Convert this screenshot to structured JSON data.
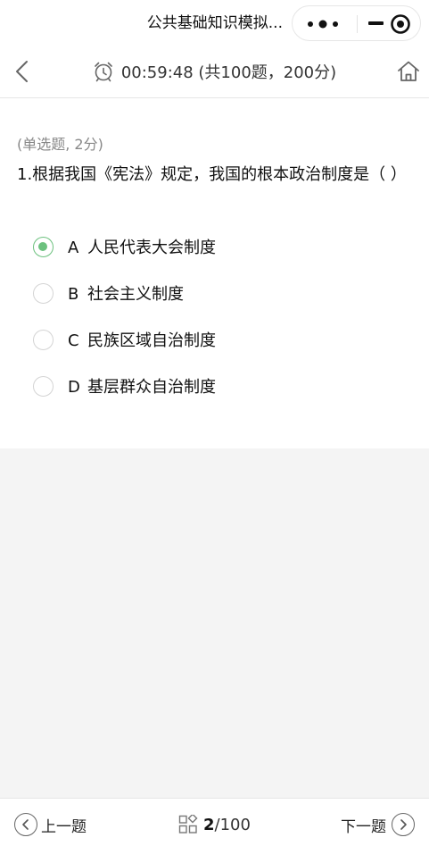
{
  "titlebar": {
    "title": "公共基础知识模拟..."
  },
  "header": {
    "timer": "00:59:48 (共100题，200分)"
  },
  "question": {
    "type": "(单选题, 2分)",
    "stem": "1.根据我国《宪法》规定，我国的根本政治制度是（ ）",
    "options": [
      {
        "letter": "A",
        "text": "人民代表大会制度",
        "selected": true
      },
      {
        "letter": "B",
        "text": "社会主义制度",
        "selected": false
      },
      {
        "letter": "C",
        "text": "民族区域自治制度",
        "selected": false
      },
      {
        "letter": "D",
        "text": "基层群众自治制度",
        "selected": false
      }
    ]
  },
  "footer": {
    "prev_label": "上一题",
    "next_label": "下一题",
    "current": "2",
    "total_suffix": "/100"
  },
  "colors": {
    "accent": "#6cc17e"
  }
}
